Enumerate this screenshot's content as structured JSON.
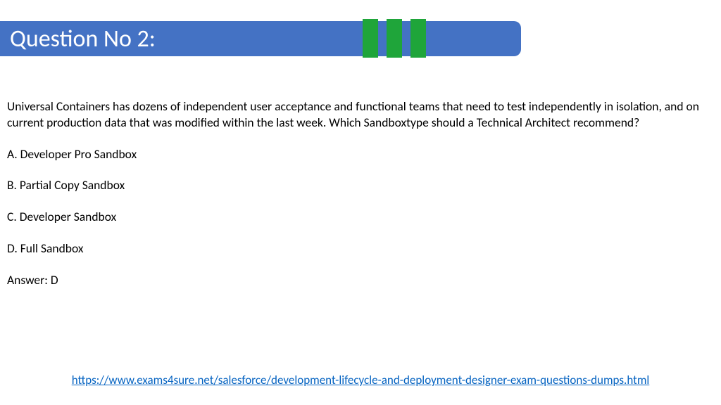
{
  "header": {
    "title": "Question No 2:"
  },
  "question": {
    "text": "Universal Containers has dozens of independent user acceptance and functional teams that need to test independently in isolation, and on current production data that was modified within the last week. Which Sandboxtype should a Technical Architect recommend?",
    "options": {
      "a": "A. Developer Pro Sandbox",
      "b": "B. Partial Copy Sandbox",
      "c": "C. Developer Sandbox",
      "d": "D. Full Sandbox"
    },
    "answer": "Answer: D"
  },
  "footer": {
    "url": "https://www.exams4sure.net/salesforce/development-lifecycle-and-deployment-designer-exam-questions-dumps.html"
  }
}
